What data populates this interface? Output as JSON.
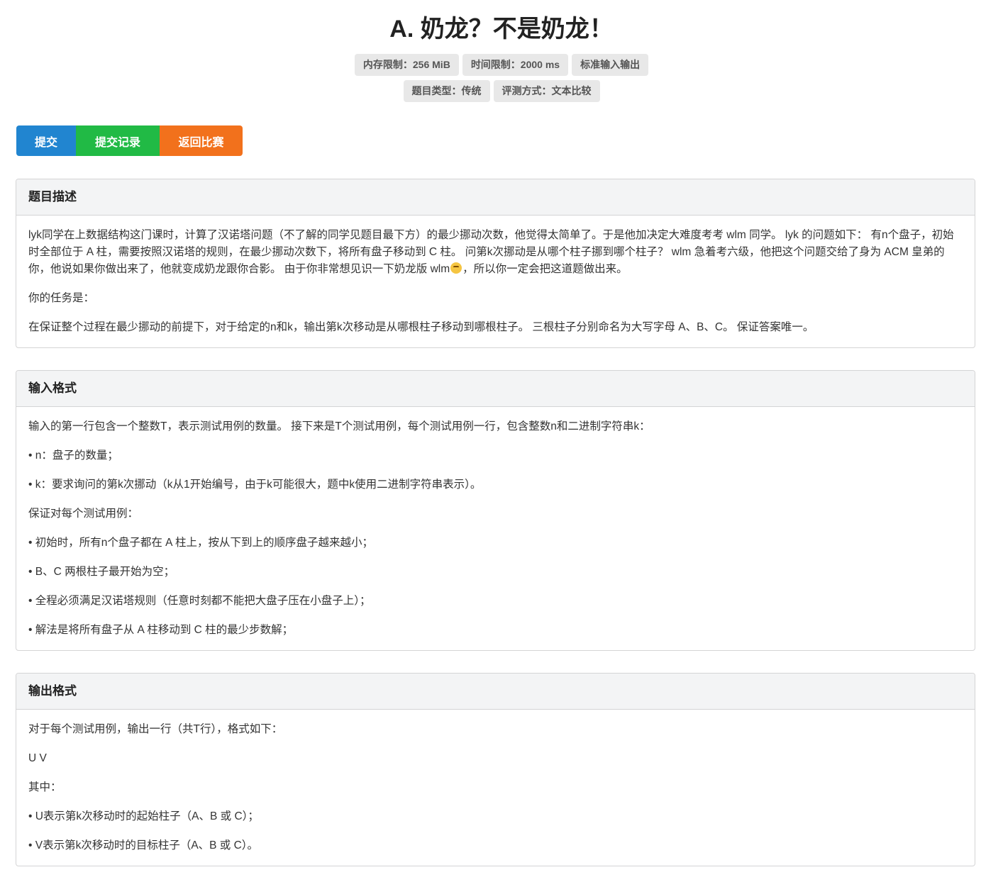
{
  "title": "A. 奶龙？不是奶龙！",
  "badges_row1": [
    "内存限制：256 MiB",
    "时间限制：2000 ms",
    "标准输入输出"
  ],
  "badges_row2": [
    "题目类型：传统",
    "评测方式：文本比较"
  ],
  "buttons": {
    "submit": "提交",
    "records": "提交记录",
    "back": "返回比赛"
  },
  "colors": {
    "submit": "#2185d0",
    "records": "#21ba45",
    "back": "#f2711c"
  },
  "sections": {
    "description": {
      "header": "题目描述",
      "p1a": "lyk同学在上数据结构这门课时，计算了汉诺塔问题（不了解的同学见题目最下方）的最少挪动次数，他觉得太简单了。于是他加决定大难度考考 wlm 同学。 lyk 的问题如下： 有n个盘子，初始时全部位于 A 柱，需要按照汉诺塔的规则，在最少挪动次数下，将所有盘子移动到 C 柱。 问第k次挪动是从哪个柱子挪到哪个柱子？ wlm 急着考六级，他把这个问题交给了身为 ACM 皇弟的你，他说如果你做出来了，他就变成奶龙跟你合影。 由于你非常想见识一下奶龙版 wlm",
      "emoji": "crying-face-emoji",
      "p1b": "，所以你一定会把这道题做出来。",
      "p2": "你的任务是：",
      "p3": "在保证整个过程在最少挪动的前提下，对于给定的n和k，输出第k次移动是从哪根柱子移动到哪根柱子。 三根柱子分别命名为大写字母 A、B、C。 保证答案唯一。"
    },
    "input": {
      "header": "输入格式",
      "paragraphs": [
        "输入的第一行包含一个整数T，表示测试用例的数量。 接下来是T个测试用例，每个测试用例一行，包含整数n和二进制字符串k：",
        "• n：盘子的数量；",
        "• k：要求询问的第k次挪动（k从1开始编号，由于k可能很大，题中k使用二进制字符串表示）。",
        "保证对每个测试用例：",
        "• 初始时，所有n个盘子都在 A 柱上，按从下到上的顺序盘子越来越小；",
        "• B、C 两根柱子最开始为空；",
        "• 全程必须满足汉诺塔规则（任意时刻都不能把大盘子压在小盘子上）；",
        "• 解法是将所有盘子从 A 柱移动到 C 柱的最少步数解；"
      ]
    },
    "output": {
      "header": "输出格式",
      "paragraphs": [
        "对于每个测试用例，输出一行（共T行），格式如下：",
        "U V",
        "其中：",
        "• U表示第k次移动时的起始柱子（A、B 或 C）；",
        "• V表示第k次移动时的目标柱子（A、B 或 C）。"
      ]
    }
  }
}
